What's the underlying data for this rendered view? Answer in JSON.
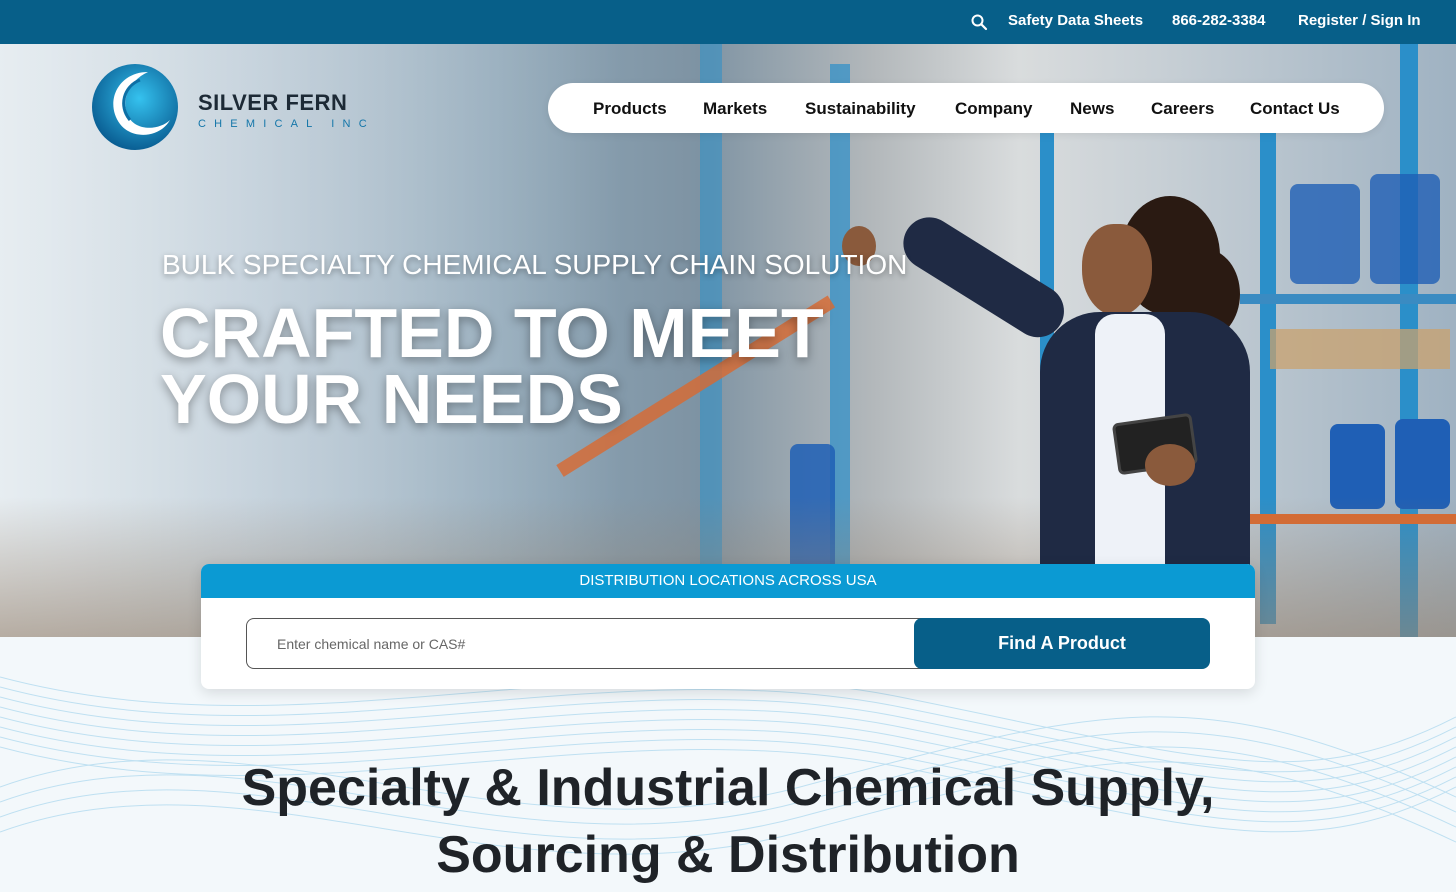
{
  "topbar": {
    "links": [
      "Safety Data Sheets",
      "866-282-3384",
      "Register / Sign In"
    ]
  },
  "logo": {
    "name": "SILVER FERN",
    "sub": "CHEMICAL INC"
  },
  "nav": {
    "items": [
      "Products",
      "Markets",
      "Sustainability",
      "Company",
      "News",
      "Careers",
      "Contact Us"
    ]
  },
  "hero": {
    "eyebrow": "BULK SPECIALTY CHEMICAL SUPPLY CHAIN SOLUTION",
    "headline_line1": "CRAFTED TO MEET",
    "headline_line2": "YOUR NEEDS"
  },
  "search": {
    "banner": "DISTRIBUTION LOCATIONS ACROSS USA",
    "placeholder": "Enter chemical name or CAS#",
    "button": "Find A Product"
  },
  "section": {
    "title_line1": "Specialty & Industrial Chemical Supply,",
    "title_line2": "Sourcing & Distribution"
  },
  "colors": {
    "brand_dark": "#075f89",
    "brand_light": "#0b9ad3",
    "text_dark": "#1f2328"
  },
  "icons": {
    "search": "search-icon",
    "logo_mark": "logo-swirl-icon"
  }
}
